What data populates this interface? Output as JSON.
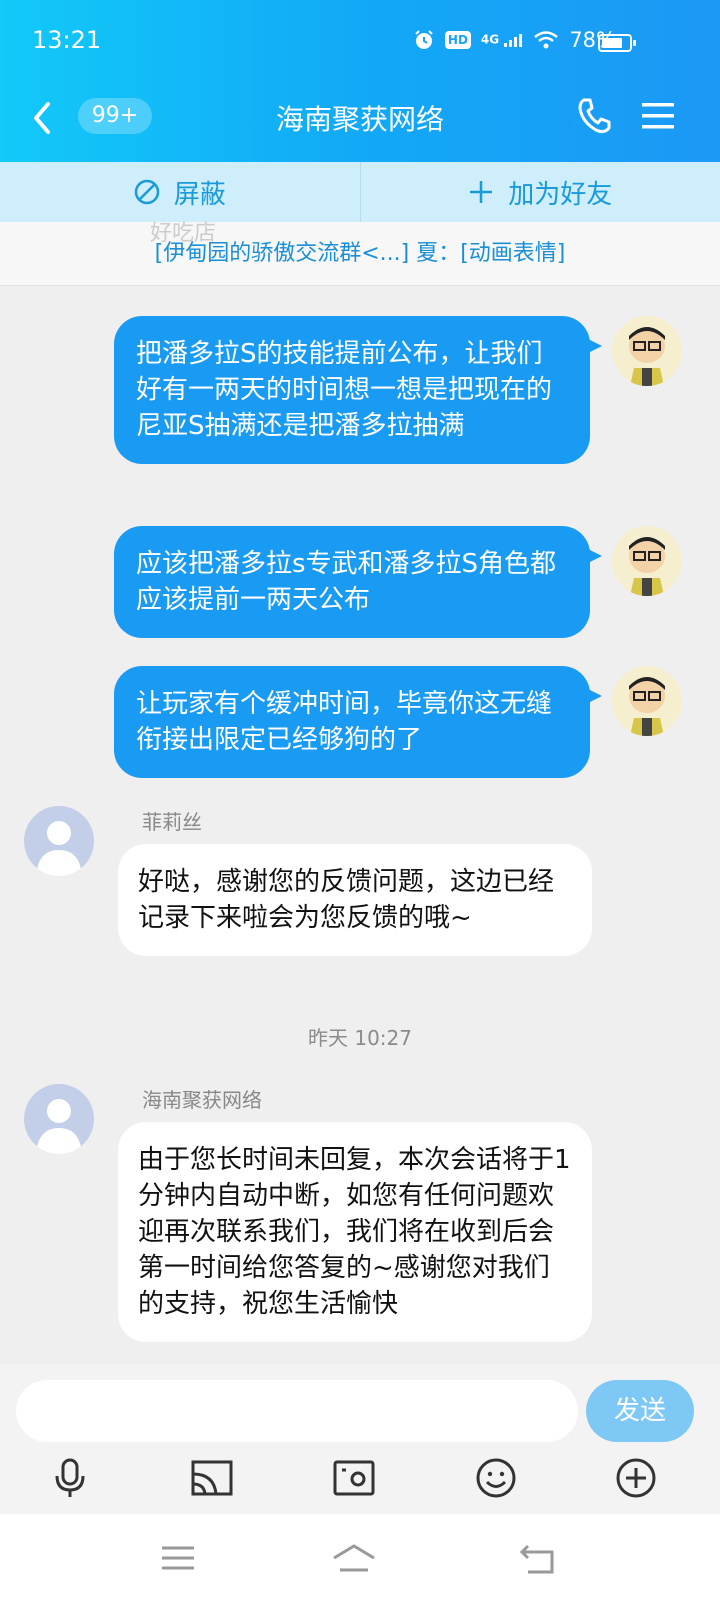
{
  "status_bar": {
    "time": "13:21",
    "hd_label": "HD",
    "network_label": "4G",
    "battery": "78%",
    "battery_level": 0.78
  },
  "nav": {
    "unread_badge": "99+",
    "title": "海南聚获网络"
  },
  "actions": {
    "block_label": "屏蔽",
    "add_friend_label": "加为好友"
  },
  "notice": {
    "ghost_text": "好吃店",
    "text": "[伊甸园的骄傲交流群<...] 夏：[动画表情]"
  },
  "messages": [
    {
      "side": "out",
      "text": "把潘多拉S的技能提前公布，让我们好有一两天的时间想一想是把现在的尼亚S抽满还是把潘多拉抽满"
    },
    {
      "side": "out",
      "text": "应该把潘多拉s专武和潘多拉S角色都应该提前一两天公布"
    },
    {
      "side": "out",
      "text": "让玩家有个缓冲时间，毕竟你这无缝衔接出限定已经够狗的了"
    },
    {
      "side": "in",
      "sender": "菲莉丝",
      "text": "好哒，感谢您的反馈问题，这边已经记录下来啦会为您反馈的哦~"
    },
    {
      "type": "timestamp",
      "text": "昨天 10:27"
    },
    {
      "side": "in",
      "sender": "海南聚获网络",
      "text": "由于您长时间未回复，本次会话将于1分钟内自动中断，如您有任何问题欢迎再次联系我们，我们将在收到后会第一时间给您答复的~感谢您对我们的支持，祝您生活愉快"
    }
  ],
  "input": {
    "placeholder": "",
    "send_label": "发送"
  },
  "icons": {
    "accent": "#1a9bf3",
    "tools": [
      "microphone-icon",
      "cast-icon",
      "photo-icon",
      "emoji-icon",
      "plus-icon"
    ]
  }
}
